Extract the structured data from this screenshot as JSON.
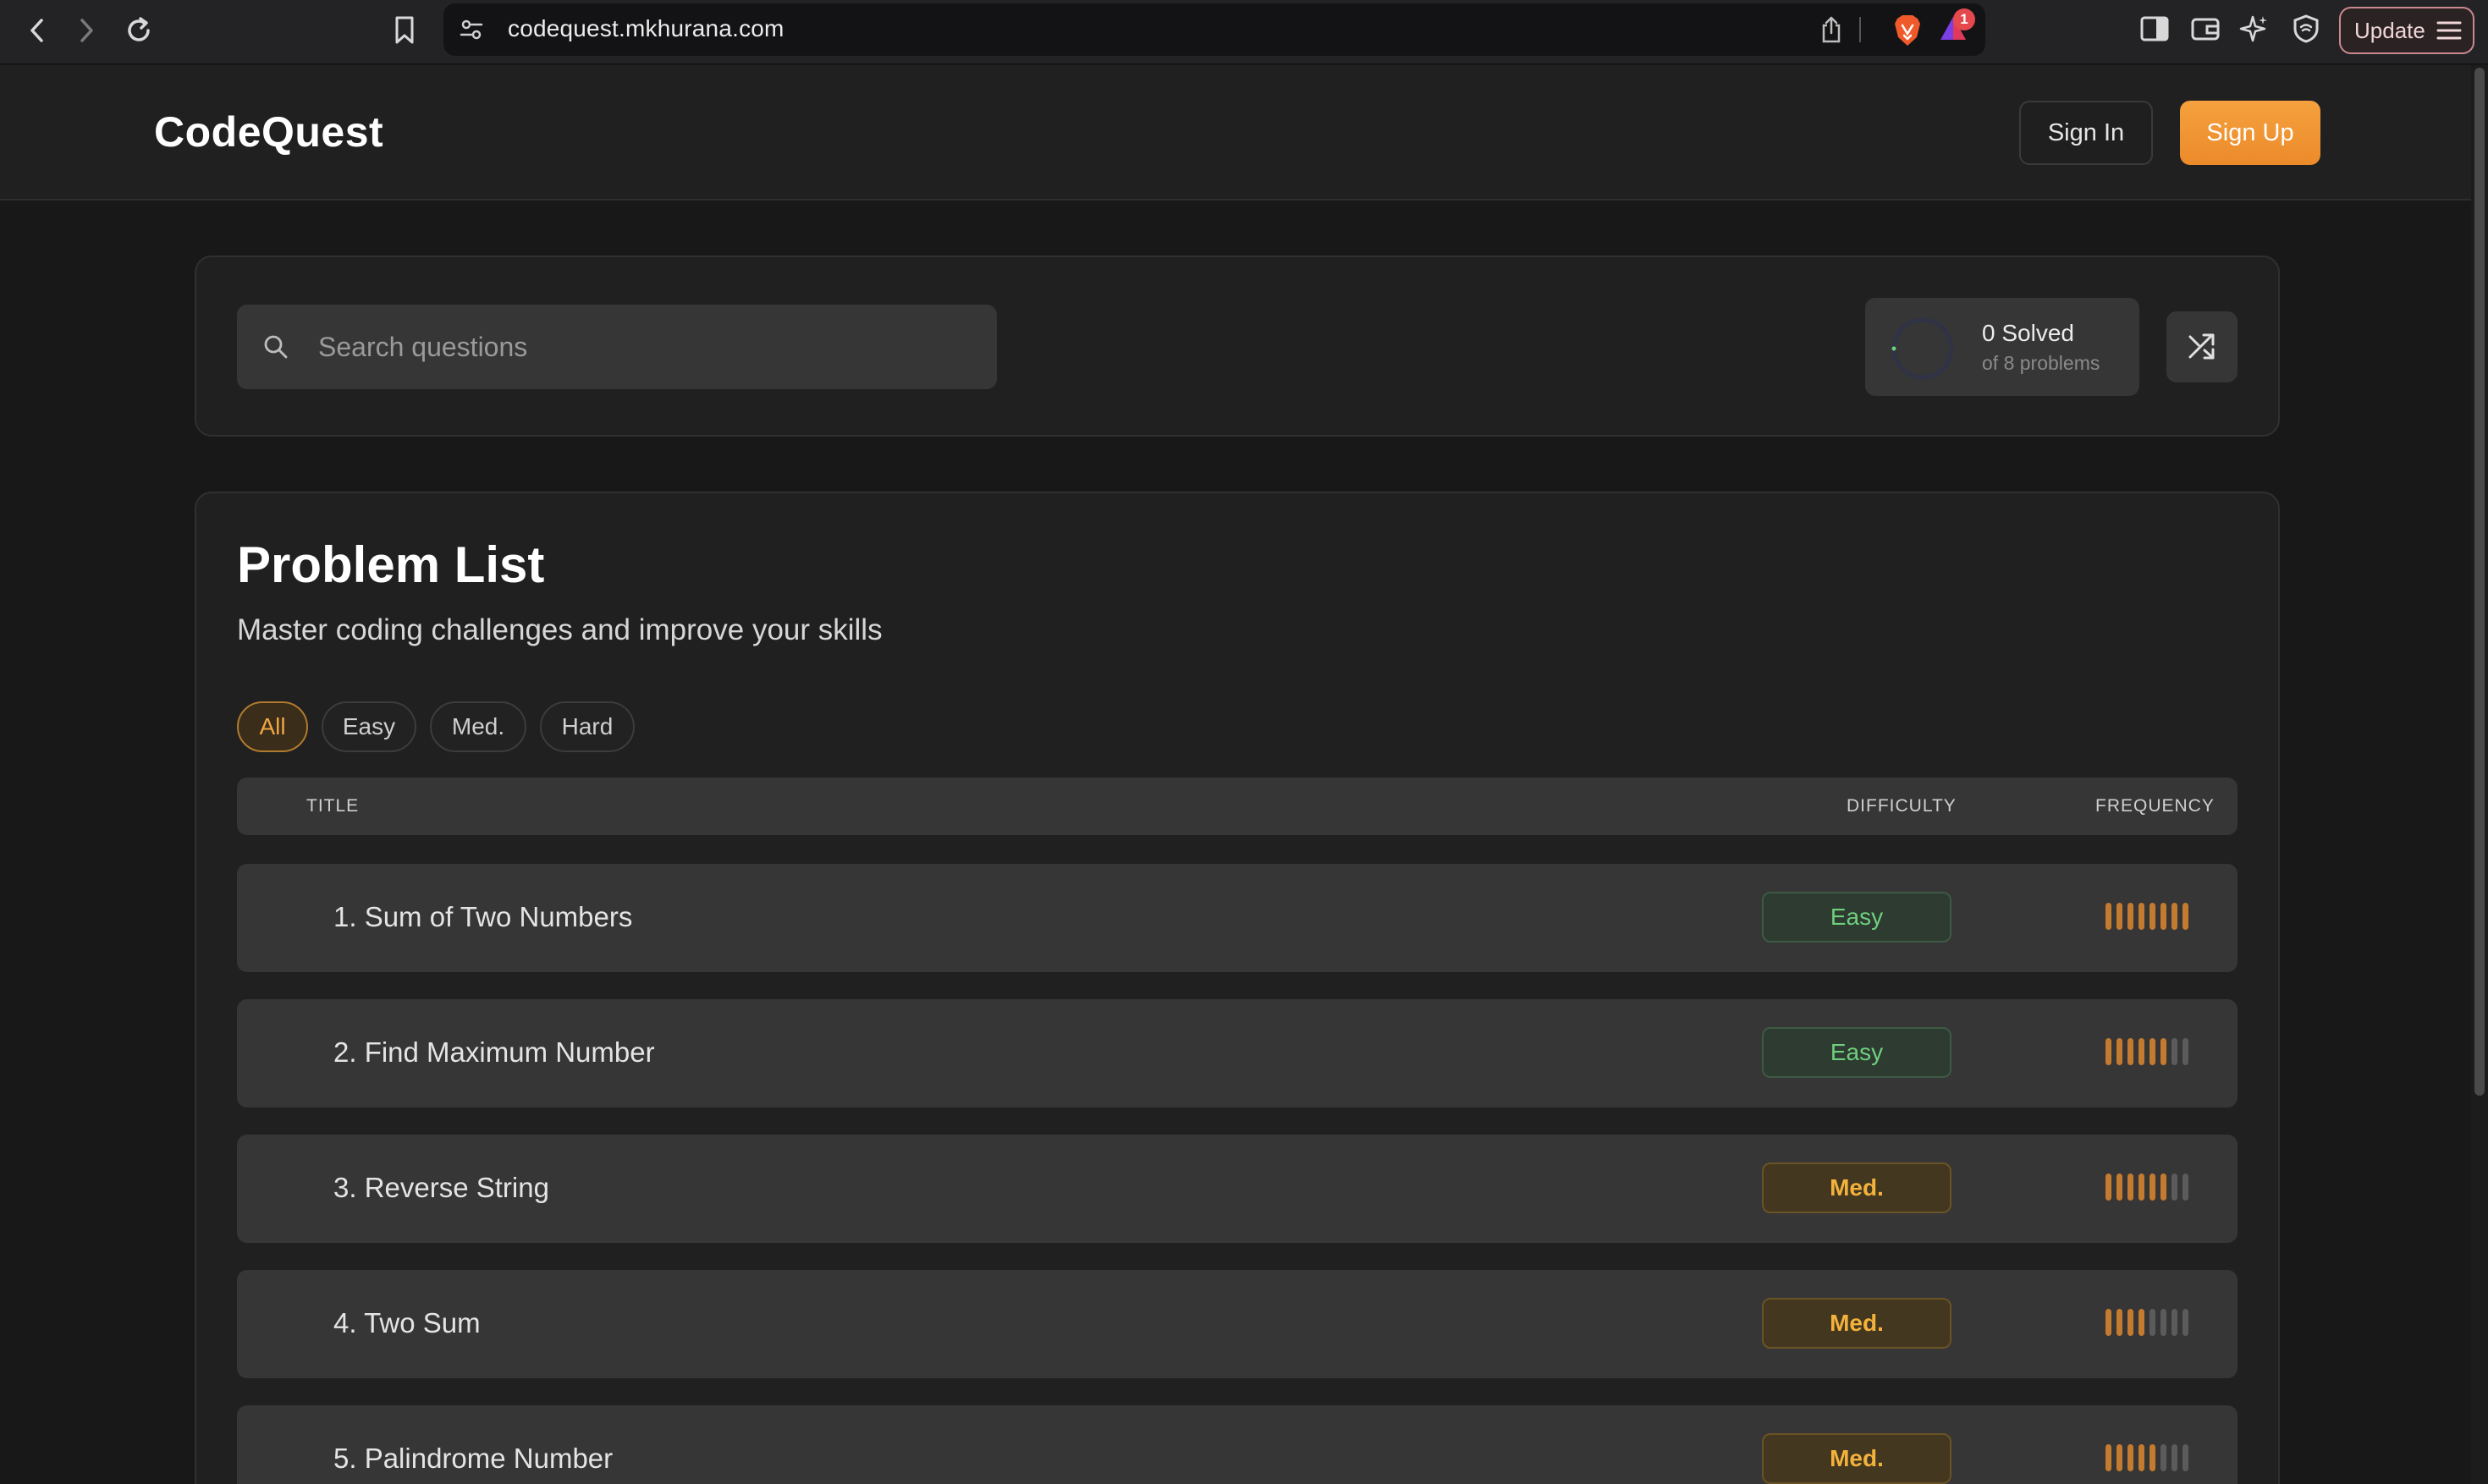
{
  "browser": {
    "url": "codequest.mkhurana.com",
    "rewards_badge": "1",
    "update_label": "Update"
  },
  "header": {
    "logo": "CodeQuest",
    "signin_label": "Sign In",
    "signup_label": "Sign Up"
  },
  "search": {
    "placeholder": "Search questions",
    "value": ""
  },
  "progress": {
    "solved_label": "0 Solved",
    "total_label": "of 8 problems",
    "solved": 0,
    "total": 8
  },
  "problem_list": {
    "title": "Problem List",
    "subtitle": "Master coding challenges and improve your skills",
    "filters": [
      "All",
      "Easy",
      "Med.",
      "Hard"
    ],
    "active_filter": "All",
    "columns": {
      "title": "TITLE",
      "difficulty": "DIFFICULTY",
      "frequency": "FREQUENCY"
    },
    "problems": [
      {
        "title": "1. Sum of Two Numbers",
        "difficulty": "Easy",
        "frequency": 8
      },
      {
        "title": "2. Find Maximum Number",
        "difficulty": "Easy",
        "frequency": 6
      },
      {
        "title": "3. Reverse String",
        "difficulty": "Med.",
        "frequency": 6
      },
      {
        "title": "4. Two Sum",
        "difficulty": "Med.",
        "frequency": 4
      },
      {
        "title": "5. Palindrome Number",
        "difficulty": "Med.",
        "frequency": 5
      }
    ],
    "frequency_max": 8
  },
  "colors": {
    "accent": "#ec8a2a",
    "easy": "#6fcf7f",
    "medium": "#f3b23c",
    "background": "#181818"
  }
}
